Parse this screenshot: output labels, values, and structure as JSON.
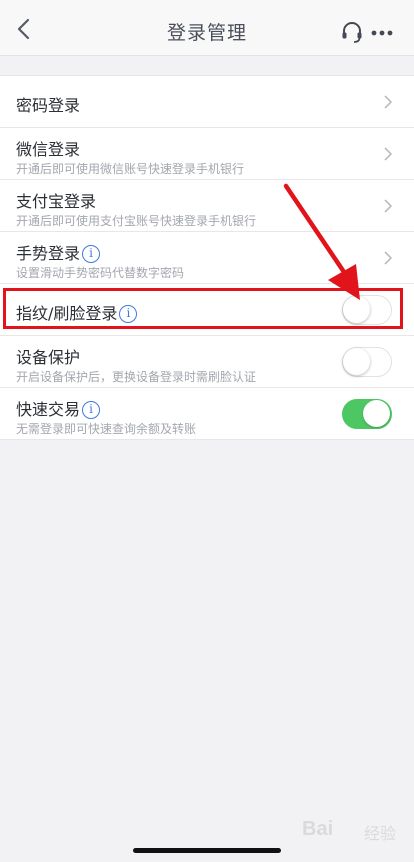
{
  "header": {
    "title": "登录管理",
    "back_icon": "chevron-left-icon",
    "service_icon": "headset-icon",
    "more_icon": "more-dots-icon"
  },
  "settings": {
    "password_login": {
      "label": "密码登录"
    },
    "wechat_login": {
      "label": "微信登录",
      "desc": "开通后即可使用微信账号快速登录手机银行"
    },
    "alipay_login": {
      "label": "支付宝登录",
      "desc": "开通后即可使用支付宝账号快速登录手机银行"
    },
    "gesture_login": {
      "label": "手势登录",
      "desc": "设置滑动手势密码代替数字密码"
    },
    "fingerprint_face_login": {
      "label": "指纹/刷脸登录",
      "enabled": false
    },
    "device_protection": {
      "label": "设备保护",
      "desc": "开启设备保护后，更换设备登录时需刷脸认证",
      "enabled": false
    },
    "quick_transaction": {
      "label": "快速交易",
      "desc": "无需登录即可快速查询余额及转账",
      "enabled": true
    }
  },
  "annotation": {
    "highlight_color": "#e2141b",
    "arrow_color": "#e2141b"
  },
  "colors": {
    "toggle_on": "#4cc763",
    "info_icon": "#3e7be0"
  },
  "watermark": {
    "text": "Bai",
    "sub": "经验"
  }
}
